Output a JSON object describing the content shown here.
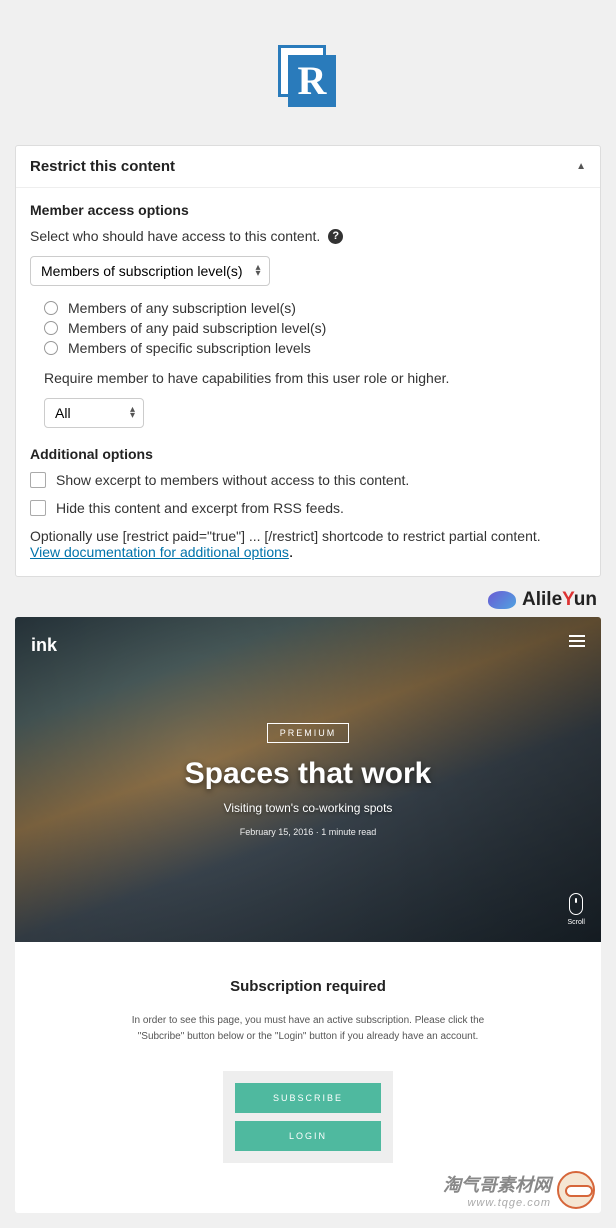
{
  "panel": {
    "title": "Restrict this content",
    "section1": "Member access options",
    "select_desc": "Select who should have access to this content.",
    "dropdown1": "Members of subscription level(s)",
    "radios": [
      "Members of any subscription level(s)",
      "Members of any paid subscription level(s)",
      "Members of specific subscription levels"
    ],
    "role_desc": "Require member to have capabilities from this user role or higher.",
    "dropdown2": "All",
    "section2": "Additional options",
    "checkboxes": [
      "Show excerpt to members without access to this content.",
      "Hide this content and excerpt from RSS feeds."
    ],
    "optional": "Optionally use [restrict paid=\"true\"] ... [/restrict] shortcode to restrict partial content.",
    "doc_link": "View documentation for additional options"
  },
  "watermark1": {
    "prefix": "Alile",
    "mid": "Y",
    "suffix": "un"
  },
  "preview": {
    "logo": "ink",
    "badge": "PREMIUM",
    "title": "Spaces that work",
    "subtitle": "Visiting town's co-working spots",
    "meta": "February 15, 2016 · 1 minute read",
    "scroll": "Scroll",
    "req_title": "Subscription required",
    "req_desc": "In order to see this page, you must have an active subscription. Please click the \"Subcribe\" button below or the \"Login\" button if you already have an account.",
    "btn1": "SUBSCRIBE",
    "btn2": "LOGIN"
  },
  "watermark2": {
    "cn": "淘气哥素材网",
    "url": "www.tqge.com"
  }
}
